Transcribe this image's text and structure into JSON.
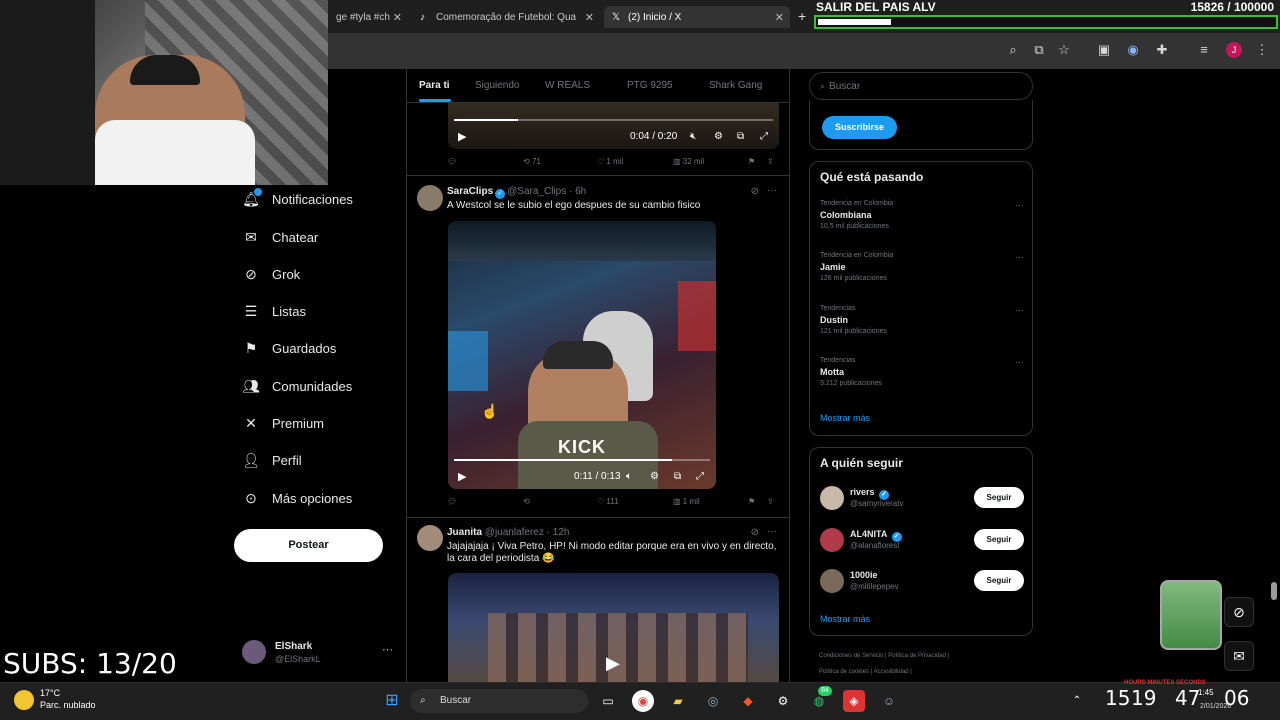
{
  "browser": {
    "tabs": [
      {
        "label": "ge #tyla #ch"
      },
      {
        "label": "Comemoração de Futebol: Qua"
      },
      {
        "label": "(2) Inicio / X"
      }
    ],
    "close_glyph": "✕",
    "new_tab_glyph": "+",
    "toolbar_icons": [
      "zoom-icon",
      "cast-icon",
      "star-icon",
      "screenshot-icon",
      "extension-icon",
      "puzzle-icon",
      "media-icon",
      "profile-icon",
      "menu-icon"
    ],
    "profile_initial": "J"
  },
  "goal": {
    "title": "SALIR DEL PAIS ALV",
    "count": "15826  / 100000",
    "progress": 0.158
  },
  "nav": {
    "items": [
      {
        "label": "Notificaciones",
        "icon": "bell-icon"
      },
      {
        "label": "Chatear",
        "icon": "mail-icon"
      },
      {
        "label": "Grok",
        "icon": "grok-icon"
      },
      {
        "label": "Listas",
        "icon": "list-icon"
      },
      {
        "label": "Guardados",
        "icon": "bookmark-icon"
      },
      {
        "label": "Comunidades",
        "icon": "people-icon"
      },
      {
        "label": "Premium",
        "icon": "x-logo-icon"
      },
      {
        "label": "Perfil",
        "icon": "person-icon"
      },
      {
        "label": "Más opciones",
        "icon": "more-icon"
      }
    ],
    "post_label": "Postear",
    "profile": {
      "name": "ElShark",
      "handle": "@ElSharkL",
      "more": "···"
    }
  },
  "overlay": {
    "subs": "SUBS: 13/20"
  },
  "timeline": {
    "tabs": [
      "Para ti",
      "Siguiendo",
      "W REALS",
      "PTG 9295",
      "Shark Gang"
    ],
    "tweets": [
      {
        "video": {
          "time": "0:04 / 0:20",
          "progress": 0.2
        },
        "actions": {
          "reply": "",
          "retweet": "71",
          "like": "1 mil",
          "views": "32 mil"
        }
      },
      {
        "name": "SaraClips",
        "handle": "@Sara_Clips",
        "time": "· 6h",
        "text": "A Westcol se le subio el ego despues de su cambio fisico",
        "video": {
          "time": "0:11 / 0:13",
          "progress": 0.85,
          "overlay_text": "KICK"
        },
        "actions": {
          "reply": "",
          "retweet": "",
          "like": "111",
          "views": "1 mil"
        }
      },
      {
        "name": "Juanita",
        "handle": "@juanlaferez",
        "time": "· 12h",
        "text": "Jajajajaja ¡ Viva Petro, HP! Ni modo editar porque era en vivo y en directo, la cara del periodista 😂"
      }
    ]
  },
  "sidebar": {
    "search_placeholder": "Buscar",
    "subscribe_label": "Suscribirse",
    "trends_title": "Qué está pasando",
    "trends": [
      {
        "context": "Tendencia en Colombia",
        "name": "Colombiana",
        "count": "10,5 mil publicaciones"
      },
      {
        "context": "Tendencia en Colombia",
        "name": "Jamie",
        "count": "126 mil publicaciones"
      },
      {
        "context": "Tendencias",
        "name": "Dustin",
        "count": "121 mil publicaciones"
      },
      {
        "context": "Tendencias",
        "name": "Motta",
        "count": "3.212 publicaciones"
      }
    ],
    "show_more": "Mostrar más",
    "follow_title": "A quién seguir",
    "follow": [
      {
        "name": "rivers",
        "handle": "@samyriveratv",
        "button": "Seguir"
      },
      {
        "name": "AL4NITA",
        "handle": "@alanaflorest",
        "button": "Seguir"
      },
      {
        "name": "1000ie",
        "handle": "@mitilepepev",
        "button": "Seguir"
      }
    ],
    "footer": [
      "Condiciones de Servicio",
      "Política de Privacidad",
      "Política de cookies",
      "Accesibilidad"
    ]
  },
  "taskbar": {
    "weather_temp": "17°C",
    "weather_desc": "Parc. nublado",
    "search_label": "Buscar",
    "badge_count": "84",
    "clock_hours": "15",
    "clock_minutes": "19",
    "clock_h2": "47",
    "clock_s": "06",
    "clock_labels": "HOURS   MINUTES   SECONDS",
    "sys_time": "1:45",
    "sys_date": "2/01/2026"
  },
  "colors": {
    "accent": "#1d9bf0",
    "background": "#000000",
    "goal_border": "#36c236"
  }
}
